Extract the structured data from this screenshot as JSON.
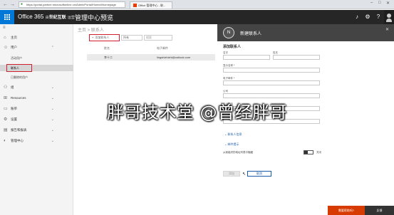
{
  "browser": {
    "address": "https://portal.partner.microsoftonline.cn/AdminPortal/Home#/homepage",
    "tab_label": "Office 管理中心 - 联...",
    "back": "←",
    "forward": "→"
  },
  "suitebar": {
    "brand_prefix": "Office 365",
    "brand_small": "由",
    "brand_bold": "世纪互联",
    "brand_suffix": "运营",
    "title": "管理中心预览"
  },
  "nav": {
    "collapse": "≡",
    "items": [
      {
        "label": "主页",
        "icon": "home-icon"
      },
      {
        "label": "用户",
        "icon": "person-icon"
      },
      {
        "label": "活动用户"
      },
      {
        "label": "联系人"
      },
      {
        "label": "已删除的用户"
      },
      {
        "label": "组",
        "icon": "group-icon"
      },
      {
        "label": "Resources",
        "icon": "resources-icon"
      },
      {
        "label": "账单",
        "icon": "billing-icon"
      },
      {
        "label": "设置",
        "icon": "settings-icon"
      },
      {
        "label": "报告和报表",
        "icon": "reports-icon"
      },
      {
        "label": "管理中心",
        "icon": "admin-icon"
      }
    ]
  },
  "main": {
    "breadcrumb": "主页 > 联系人",
    "add_contact": "添加联系人",
    "filter": "所有",
    "search_placeholder": "搜索",
    "columns": [
      "姓名",
      "电子邮件"
    ],
    "rows": [
      {
        "name": "李十二",
        "email": "lingshizhizhi@outlook.com"
      }
    ]
  },
  "panel": {
    "avatar_initial": "N",
    "title": "新建联系人",
    "subtitle": "添加联系人",
    "fields": {
      "first_name": "名字",
      "last_name": "姓氏",
      "display_name": "显示名称 *",
      "email": "电子邮件 *",
      "company": "公司",
      "office_phone": "办公电话",
      "mobile": "移动电话"
    },
    "section_contact": "联系人信息",
    "section_mail": "邮件提示",
    "toggle_label": "从我组织的地址列表中隐藏",
    "toggle_state": "关闭",
    "save": "添加",
    "cancel": "取消"
  },
  "bottom": {
    "help": "需要帮助吗?",
    "feedback": "反馈"
  },
  "watermark": "胖哥技术堂 @曾经胖哥"
}
